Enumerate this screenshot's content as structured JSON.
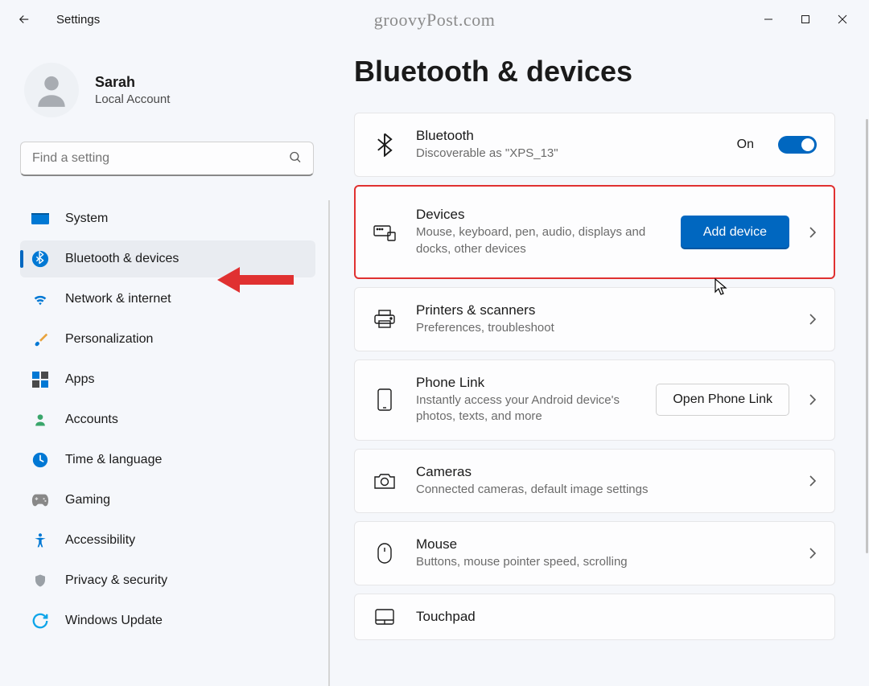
{
  "window": {
    "title": "Settings",
    "watermark": "groovyPost.com"
  },
  "user": {
    "name": "Sarah",
    "accountType": "Local Account"
  },
  "search": {
    "placeholder": "Find a setting"
  },
  "nav": {
    "items": [
      {
        "label": "System"
      },
      {
        "label": "Bluetooth & devices"
      },
      {
        "label": "Network & internet"
      },
      {
        "label": "Personalization"
      },
      {
        "label": "Apps"
      },
      {
        "label": "Accounts"
      },
      {
        "label": "Time & language"
      },
      {
        "label": "Gaming"
      },
      {
        "label": "Accessibility"
      },
      {
        "label": "Privacy & security"
      },
      {
        "label": "Windows Update"
      }
    ],
    "activeIndex": 1
  },
  "page": {
    "title": "Bluetooth & devices"
  },
  "bluetooth": {
    "title": "Bluetooth",
    "subtitle": "Discoverable as \"XPS_13\"",
    "stateLabel": "On"
  },
  "devices": {
    "title": "Devices",
    "subtitle": "Mouse, keyboard, pen, audio, displays and docks, other devices",
    "button": "Add device"
  },
  "cards": [
    {
      "title": "Printers & scanners",
      "subtitle": "Preferences, troubleshoot"
    },
    {
      "title": "Phone Link",
      "subtitle": "Instantly access your Android device's photos, texts, and more",
      "button": "Open Phone Link"
    },
    {
      "title": "Cameras",
      "subtitle": "Connected cameras, default image settings"
    },
    {
      "title": "Mouse",
      "subtitle": "Buttons, mouse pointer speed, scrolling"
    },
    {
      "title": "Touchpad",
      "subtitle": ""
    }
  ],
  "colors": {
    "accent": "#0067c0",
    "highlight": "#e03131"
  }
}
